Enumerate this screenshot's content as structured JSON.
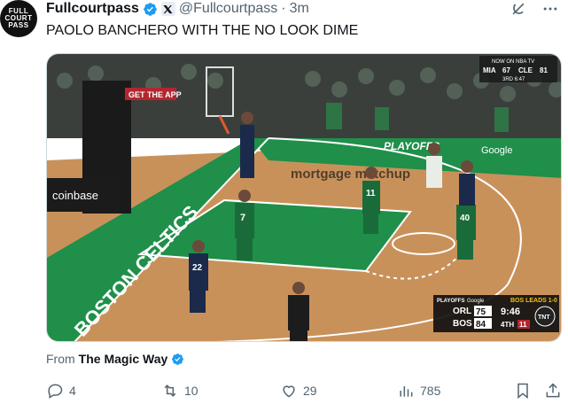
{
  "avatar": {
    "lines": [
      "FULL",
      "COURT",
      "PASS"
    ]
  },
  "header": {
    "display_name": "Fullcourtpass",
    "handle": "@Fullcourtpass",
    "separator": "·",
    "time": "3m"
  },
  "tweet": {
    "text": "PAOLO BANCHERO WITH THE NO LOOK DIME"
  },
  "media": {
    "top_bug": {
      "line1": "NOW ON NBA TV",
      "team1": "MIA",
      "score1": "67",
      "team2": "CLE",
      "score2": "81",
      "period": "3RD 6:47"
    },
    "scoreboard": {
      "header_left": "PLAYOFFS",
      "header_mid": "Google",
      "series": "BOS LEADS 1-0",
      "away_team": "ORL",
      "away_score": "75",
      "home_team": "BOS",
      "home_score": "84",
      "clock": "9:46",
      "quarter": "4TH",
      "shot_clock": "11",
      "network": "TNT"
    },
    "court_text": {
      "sideline": "BOSTON CELTICS",
      "sponsor": "mortgage matchup",
      "coinbase": "coinbase",
      "banner": "GET THE APP",
      "playoffs": "PLAYOFFS",
      "fans": "Google"
    },
    "jerseys": {
      "p1": "7",
      "p2": "11",
      "p3": "40",
      "p4": "22",
      "p5": "11"
    }
  },
  "source": {
    "label": "From",
    "name": "The Magic Way"
  },
  "actions": {
    "replies": "4",
    "reposts": "10",
    "likes": "29",
    "views": "785"
  },
  "colors": {
    "verified": "#1d9bf0",
    "court_green": "#1f8f4a",
    "floor": "#c9915a",
    "celtics_green": "#1a6b3a",
    "magic_blue": "#1b2a4a"
  }
}
